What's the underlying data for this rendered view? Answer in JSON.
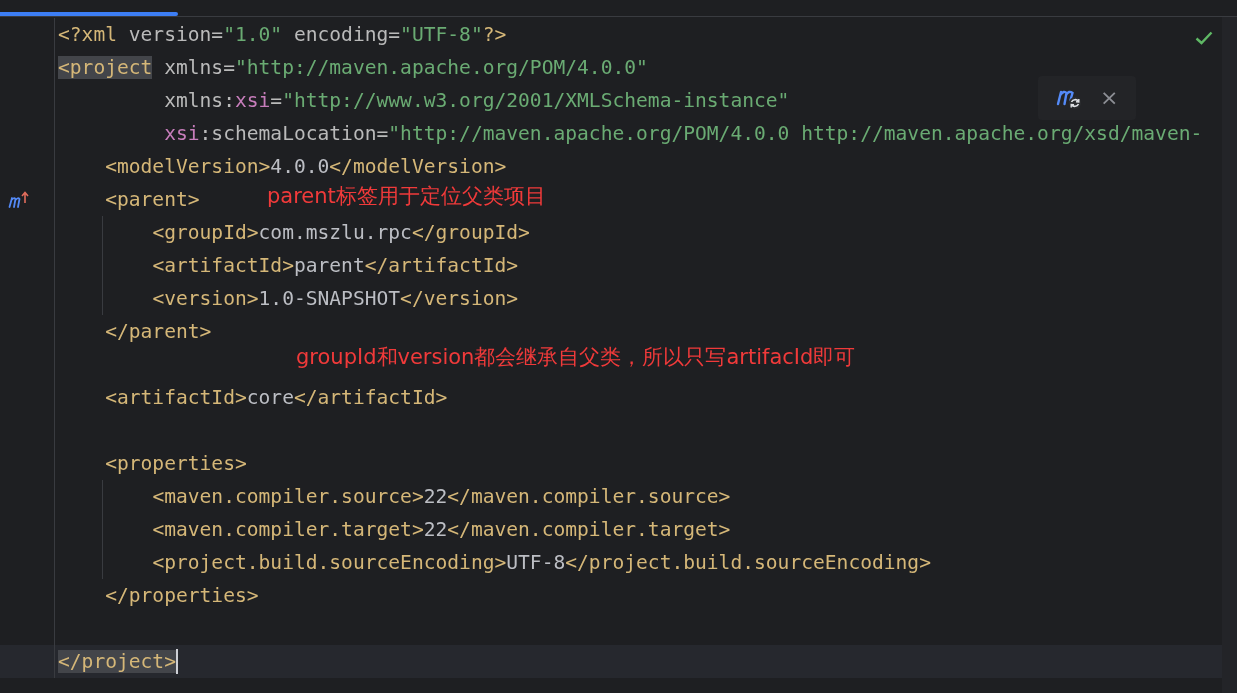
{
  "progress": {
    "level": 0.144
  },
  "blocks": [
    {
      "lines": [
        {
          "tokens": [
            {
              "kind": "tag",
              "text": "<?xml "
            },
            {
              "kind": "attr",
              "text": "version="
            },
            {
              "kind": "value",
              "text": "\"1.0\""
            },
            {
              "kind": "attr",
              "text": " encoding="
            },
            {
              "kind": "value",
              "text": "\"UTF-8\""
            },
            {
              "kind": "tag",
              "text": "?>"
            }
          ]
        },
        {
          "tokens": [
            {
              "kind": "tag",
              "text": "<project",
              "matched": true
            },
            {
              "kind": "attr",
              "text": " xmlns="
            },
            {
              "kind": "value",
              "text": "\"http://maven.apache.org/POM/4.0.0\""
            }
          ]
        },
        {
          "tokens": [
            {
              "kind": "attr",
              "text": "         xmlns:"
            },
            {
              "kind": "ns",
              "text": "xsi"
            },
            {
              "kind": "attr",
              "text": "="
            },
            {
              "kind": "value",
              "text": "\"http://www.w3.org/2001/XMLSchema-instance\""
            }
          ]
        },
        {
          "tokens": [
            {
              "kind": "ns",
              "text": "         xsi"
            },
            {
              "kind": "attr",
              "text": ":schemaLocation="
            },
            {
              "kind": "value",
              "text": "\"http://maven.apache.org/POM/4.0.0 http://maven.apache.org/xsd/maven-"
            }
          ]
        },
        {
          "tokens": [
            {
              "kind": "tag",
              "text": "    <modelVersion>"
            },
            {
              "kind": "text",
              "text": "4.0.0"
            },
            {
              "kind": "tag",
              "text": "</modelVersion>"
            }
          ]
        },
        {
          "parent_link": true,
          "tokens": [
            {
              "kind": "tag",
              "text": "    <parent>"
            }
          ]
        },
        {
          "indent_guide": true,
          "tokens": [
            {
              "kind": "tag",
              "text": "        <groupId>"
            },
            {
              "kind": "text",
              "text": "com.mszlu.rpc"
            },
            {
              "kind": "tag",
              "text": "</groupId>"
            }
          ]
        },
        {
          "indent_guide": true,
          "tokens": [
            {
              "kind": "tag",
              "text": "        <artifactId>"
            },
            {
              "kind": "text",
              "text": "parent"
            },
            {
              "kind": "tag",
              "text": "</artifactId>"
            }
          ]
        },
        {
          "indent_guide": true,
          "tokens": [
            {
              "kind": "tag",
              "text": "        <version>"
            },
            {
              "kind": "text",
              "text": "1.0-SNAPSHOT"
            },
            {
              "kind": "tag",
              "text": "</version>"
            }
          ]
        },
        {
          "tokens": [
            {
              "kind": "tag",
              "text": "    </parent>"
            }
          ]
        }
      ]
    },
    {
      "lines": [
        {
          "tokens": [
            {
              "kind": "tag",
              "text": "    <artifactId>"
            },
            {
              "kind": "text",
              "text": "core"
            },
            {
              "kind": "tag",
              "text": "</artifactId>"
            }
          ]
        }
      ]
    },
    {
      "lines": [
        {
          "tokens": [
            {
              "kind": "tag",
              "text": "    <properties>"
            }
          ]
        },
        {
          "indent_guide": true,
          "tokens": [
            {
              "kind": "tag",
              "text": "        <maven.compiler.source>"
            },
            {
              "kind": "text",
              "text": "22"
            },
            {
              "kind": "tag",
              "text": "</maven.compiler.source>"
            }
          ]
        },
        {
          "indent_guide": true,
          "tokens": [
            {
              "kind": "tag",
              "text": "        <maven.compiler.target>"
            },
            {
              "kind": "text",
              "text": "22"
            },
            {
              "kind": "tag",
              "text": "</maven.compiler.target>"
            }
          ]
        },
        {
          "indent_guide": true,
          "tokens": [
            {
              "kind": "tag",
              "text": "        <project.build.sourceEncoding>"
            },
            {
              "kind": "text",
              "text": "UTF-8"
            },
            {
              "kind": "tag",
              "text": "</project.build.sourceEncoding>"
            }
          ]
        },
        {
          "tokens": [
            {
              "kind": "tag",
              "text": "    </properties>"
            }
          ]
        }
      ]
    },
    {
      "lines": [
        {
          "current": true,
          "caret": true,
          "tokens": [
            {
              "kind": "tag",
              "text": "</project>",
              "matched": true
            }
          ]
        }
      ]
    }
  ],
  "annotations": [
    {
      "text": "parent标签用于定位父类项目"
    },
    {
      "text": "groupId和version都会继承自父类，所以只写artifacId即可"
    }
  ],
  "popup": {
    "close": "×"
  }
}
